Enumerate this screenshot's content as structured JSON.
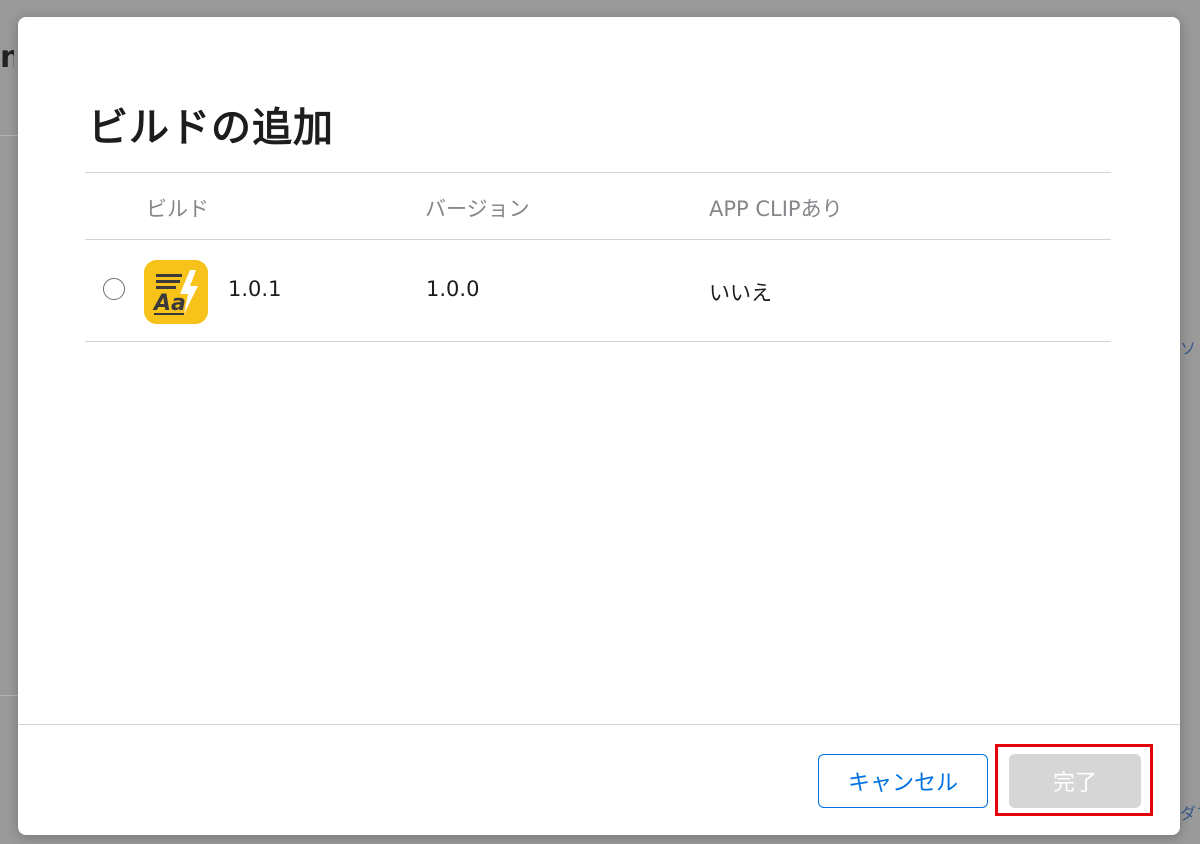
{
  "background": {
    "edge_letter": "n",
    "edge_text_1": "ソ",
    "edge_text_2": "ダフ"
  },
  "dialog": {
    "title": "ビルドの追加",
    "table": {
      "columns": [
        "ビルド",
        "バージョン",
        "APP CLIPあり"
      ],
      "rows": [
        {
          "selected": false,
          "app_icon": "app-icon-font-aa-lightning",
          "build": "1.0.1",
          "version": "1.0.0",
          "app_clip": "いいえ"
        }
      ]
    },
    "buttons": {
      "cancel": "キャンセル",
      "done": "完了"
    }
  },
  "colors": {
    "accent": "#0071e3",
    "disabled_button": "#d6d6d6",
    "highlight": "#e5000a",
    "app_icon": "#f7c21a"
  }
}
